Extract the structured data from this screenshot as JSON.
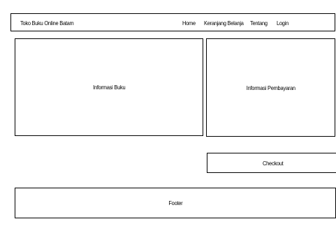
{
  "header": {
    "site_title": "Toko Buku Online Batam",
    "nav": {
      "home": "Home",
      "cart": "Keranjang Belanja",
      "about": "Tentang",
      "login": "Login"
    }
  },
  "main": {
    "book_info_label": "Informasi Buku",
    "payment_info_label": "Informasi Pembayaran",
    "checkout_label": "Checkout"
  },
  "footer": {
    "label": "Footer"
  }
}
